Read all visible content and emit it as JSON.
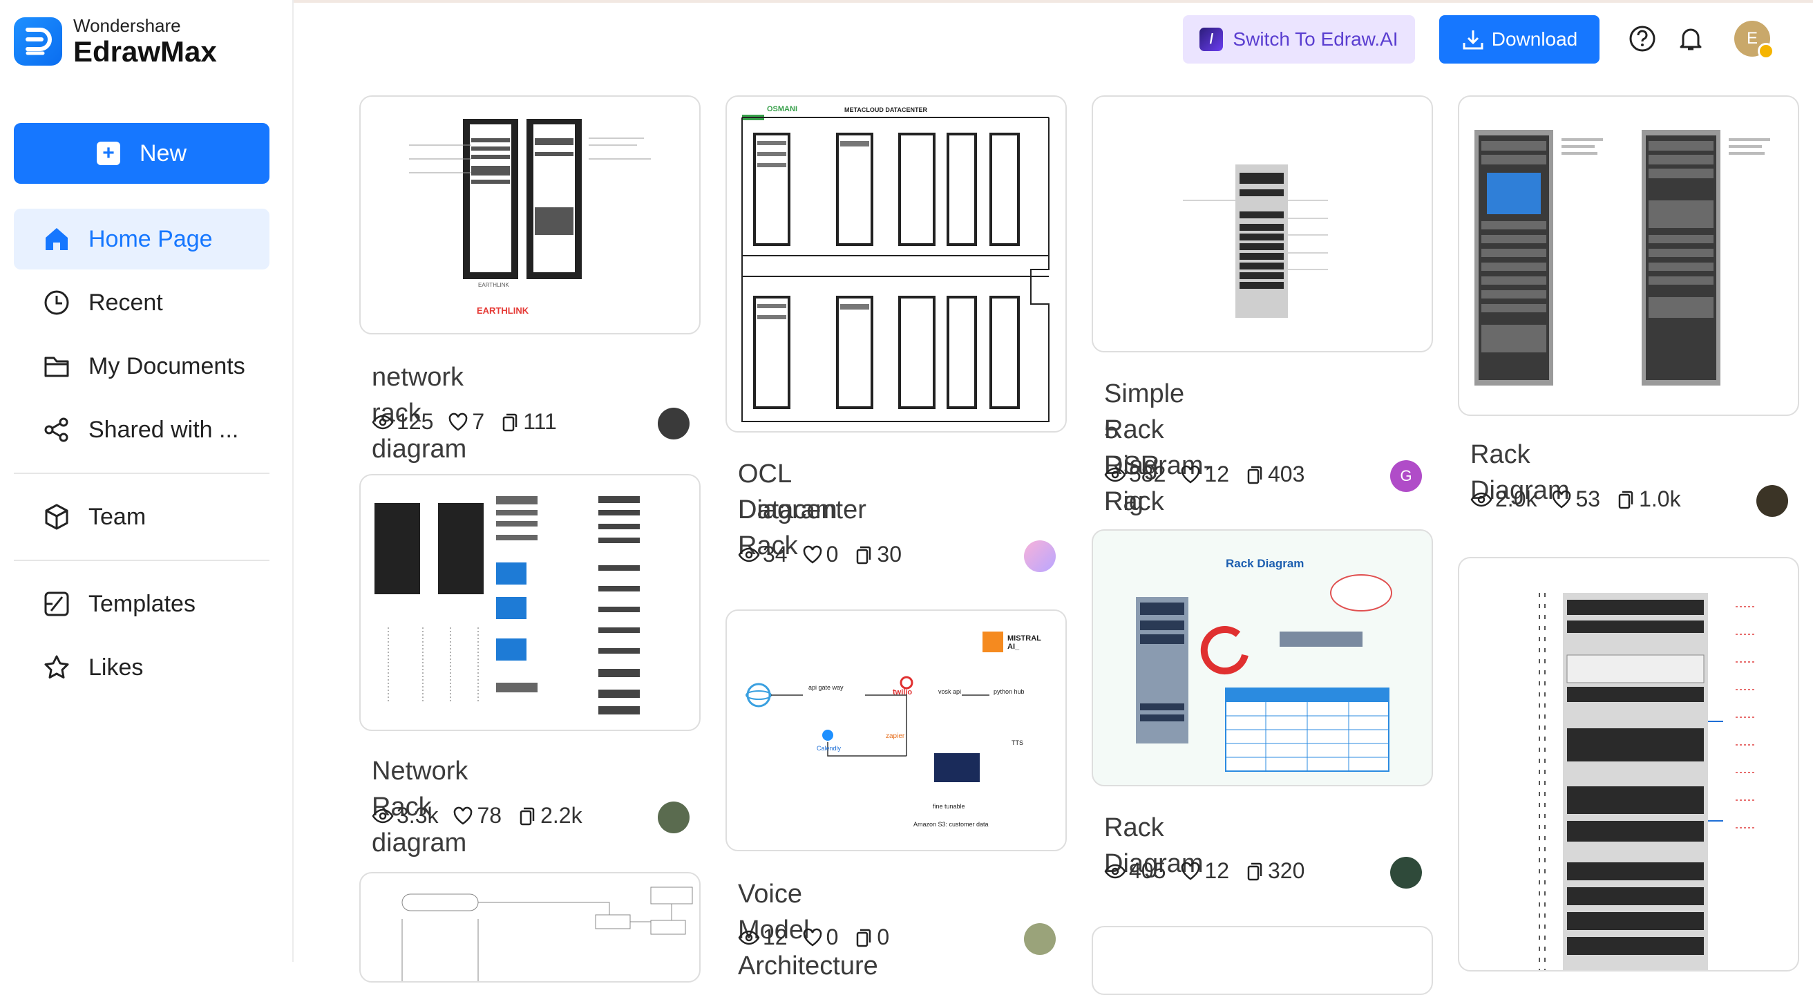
{
  "app": {
    "brand_top": "Wondershare",
    "brand_name": "EdrawMax"
  },
  "sidebar": {
    "new_label": "New",
    "items": [
      {
        "label": "Home Page",
        "icon": "home-icon",
        "active": true
      },
      {
        "label": "Recent",
        "icon": "clock-icon"
      },
      {
        "label": "My Documents",
        "icon": "folder-icon"
      },
      {
        "label": "Shared with ...",
        "icon": "share-icon"
      },
      {
        "label": "Team",
        "icon": "team-cube-icon"
      },
      {
        "label": "Templates",
        "icon": "templates-icon"
      },
      {
        "label": "Likes",
        "icon": "star-icon"
      }
    ]
  },
  "header": {
    "switch_label": "Switch To Edraw.AI",
    "download_label": "Download",
    "avatar_letter": "E"
  },
  "thumb_text": {
    "ocl_brand": "OSMANI",
    "ocl_header": "METACLOUD DATACENTER",
    "earthlink": "EARTHLINK",
    "rack_diagram_title": "Rack Diagram",
    "voice": {
      "mistral": "MISTRAL AI_",
      "twilio": "twilio",
      "api": "api gate way",
      "vosk": "vosk api",
      "python": "python hub",
      "zapier": "zapier",
      "calendly": "Calendly",
      "tts": "TTS",
      "fine": "fine tunable",
      "s3": "Amazon S3: customer data"
    }
  },
  "cards": [
    {
      "title": "network rack diagram",
      "views": "125",
      "likes": "7",
      "copies": "111"
    },
    {
      "title": "Network Rack diagram",
      "views": "3.3k",
      "likes": "78",
      "copies": "2.2k"
    },
    {
      "title_line1": "OCL Datacenter Rack",
      "title_line2": "Diagram",
      "views": "34",
      "likes": "0",
      "copies": "30"
    },
    {
      "title": "Voice Model Architecture",
      "views": "12",
      "likes": "0",
      "copies": "0"
    },
    {
      "title_line1": "Simple Rack Diagram- Rig",
      "title_line2": "5 RSR Rack",
      "views": "582",
      "likes": "12",
      "copies": "403",
      "avatar_letter": "G"
    },
    {
      "title": "Rack Diagram",
      "views": "405",
      "likes": "12",
      "copies": "320"
    },
    {
      "title": "Rack Diagram",
      "views": "2.0k",
      "likes": "53",
      "copies": "1.0k"
    }
  ],
  "colors": {
    "accent": "#1677ff",
    "active_bg": "#e8f1ff",
    "ai_bg": "#ebe4ff",
    "ai_text": "#5a3ed0",
    "avatar_g": "#b04cc8"
  }
}
